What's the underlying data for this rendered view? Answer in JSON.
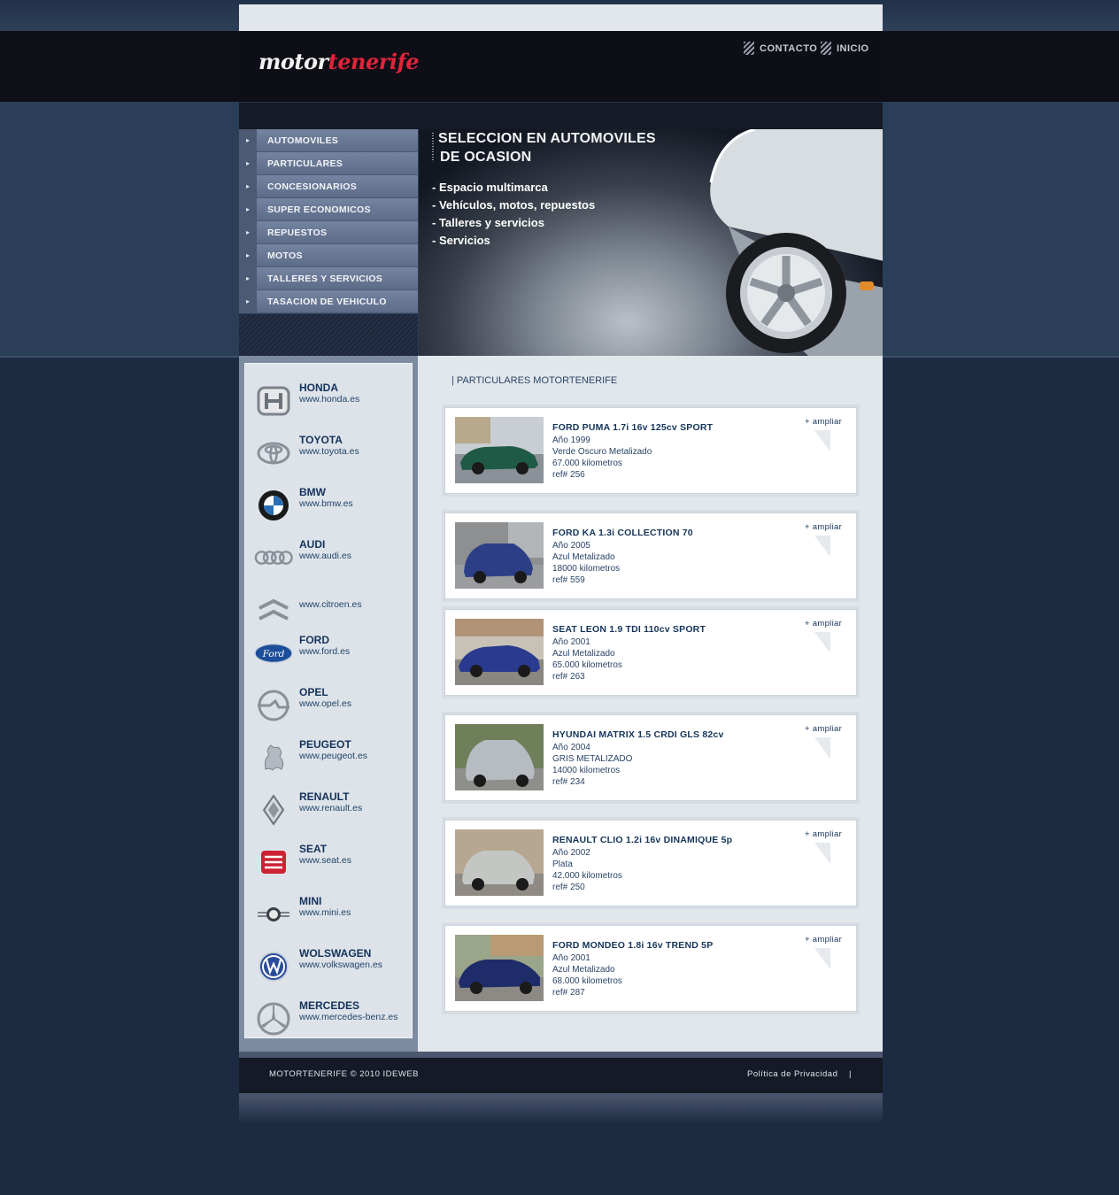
{
  "header": {
    "logo_white": "motor",
    "logo_red": "tenerife",
    "nav": [
      {
        "label": "CONTACTO"
      },
      {
        "label": "INICIO"
      }
    ]
  },
  "menu": {
    "items": [
      {
        "label": "AUTOMOVILES"
      },
      {
        "label": "PARTICULARES"
      },
      {
        "label": "CONCESIONARIOS"
      },
      {
        "label": "SUPER ECONOMICOS"
      },
      {
        "label": "REPUESTOS"
      },
      {
        "label": "MOTOS"
      },
      {
        "label": "TALLERES Y SERVICIOS"
      },
      {
        "label": "TASACION DE VEHICULO"
      }
    ]
  },
  "hero": {
    "title_line1": "SELECCION EN AUTOMOVILES",
    "title_line2": "DE OCASION",
    "bullets": [
      "- Espacio multimarca",
      "- Vehículos, motos, repuestos",
      "- Talleres y servicios",
      "- Servicios"
    ]
  },
  "brands": [
    {
      "name": "HONDA",
      "url": "www.honda.es",
      "icon": "honda-logo-icon"
    },
    {
      "name": "TOYOTA",
      "url": "www.toyota.es",
      "icon": "toyota-logo-icon"
    },
    {
      "name": "BMW",
      "url": "www.bmw.es",
      "icon": "bmw-logo-icon"
    },
    {
      "name": "AUDI",
      "url": "www.audi.es",
      "icon": "audi-logo-icon"
    },
    {
      "name": "",
      "url": "www.citroen.es",
      "icon": "citroen-logo-icon"
    },
    {
      "name": "FORD",
      "url": "www.ford.es",
      "icon": "ford-logo-icon"
    },
    {
      "name": "OPEL",
      "url": "www.opel.es",
      "icon": "opel-logo-icon"
    },
    {
      "name": "PEUGEOT",
      "url": "www.peugeot.es",
      "icon": "peugeot-logo-icon"
    },
    {
      "name": "RENAULT",
      "url": "www.renault.es",
      "icon": "renault-logo-icon"
    },
    {
      "name": "SEAT",
      "url": "www.seat.es",
      "icon": "seat-logo-icon"
    },
    {
      "name": "MINI",
      "url": "www.mini.es",
      "icon": "mini-logo-icon"
    },
    {
      "name": "WOLSWAGEN",
      "url": "www.volkswagen.es",
      "icon": "volkswagen-logo-icon"
    },
    {
      "name": "MERCEDES",
      "url": "www.mercedes-benz.es",
      "icon": "mercedes-logo-icon"
    }
  ],
  "main": {
    "section_title": "| PARTICULARES MOTORTENERIFE",
    "ampliar_label": "+ ampliar",
    "listings": [
      {
        "title": "FORD PUMA 1.7i 16v 125cv SPORT",
        "year": "Año 1999",
        "color": "Verde Oscuro Metalizado",
        "km": "67.000 kilometros",
        "ref": "ref# 256",
        "car_color": "#1f5a46"
      },
      {
        "title": "FORD KA 1.3i COLLECTION 70",
        "year": "Año 2005",
        "color": "Azul Metalizado",
        "km": "18000 kilometros",
        "ref": "ref# 559",
        "car_color": "#2c3f86"
      },
      {
        "title": "SEAT LEON 1.9 TDI 110cv SPORT",
        "year": "Año 2001",
        "color": "Azul Metalizado",
        "km": "65.000 kilometros",
        "ref": "ref# 263",
        "car_color": "#2a3a8e"
      },
      {
        "title": "HYUNDAI MATRIX 1.5 CRDI GLS 82cv",
        "year": "Año 2004",
        "color": "GRIS METALIZADO",
        "km": "14000 kilometros",
        "ref": "ref# 234",
        "car_color": "#b7bcc2"
      },
      {
        "title": "RENAULT CLIO 1.2i 16v DINAMIQUE 5p",
        "year": "Año 2002",
        "color": "Plata",
        "km": "42.000 kilometros",
        "ref": "ref# 250",
        "car_color": "#c4c6c4"
      },
      {
        "title": "FORD MONDEO 1.8i 16v TREND 5P",
        "year": "Año 2001",
        "color": "Azul Metalizado",
        "km": "68.000 kilometros",
        "ref": "ref# 287",
        "car_color": "#1f2c6a"
      }
    ]
  },
  "footer": {
    "copyright": "MOTORTENERIFE © 2010 IDEWEB",
    "privacy": "Política de Privacidad",
    "separator": "|"
  }
}
